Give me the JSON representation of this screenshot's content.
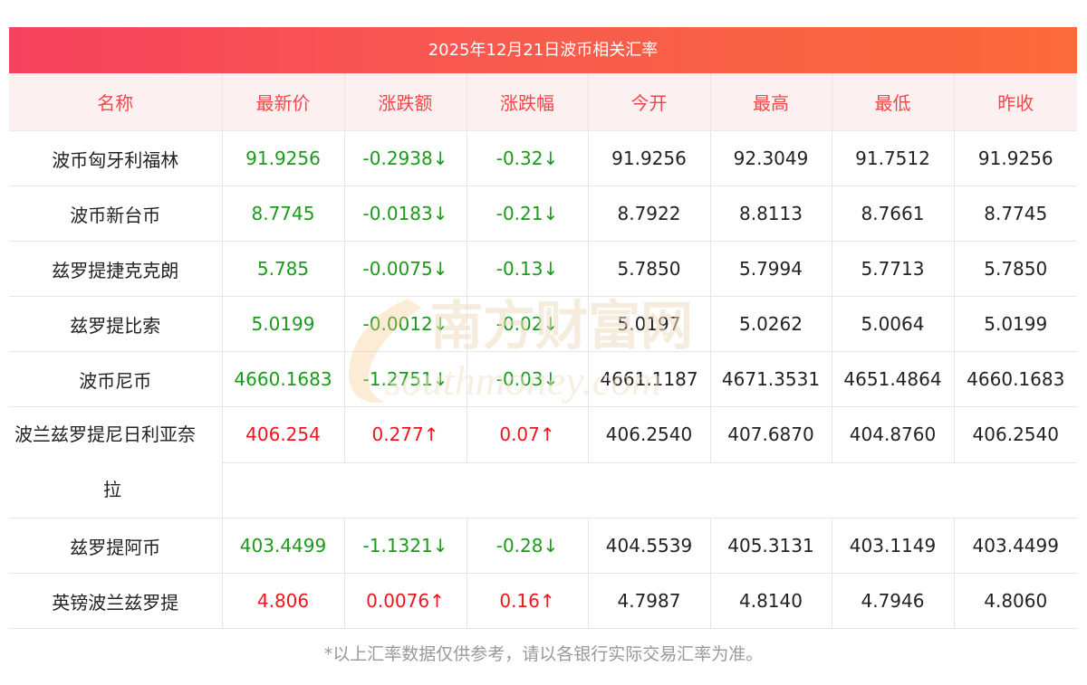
{
  "title": "2025年12月21日波币相关汇率",
  "headers": [
    "名称",
    "最新价",
    "涨跌额",
    "涨跌幅",
    "今开",
    "最高",
    "最低",
    "昨收"
  ],
  "rows": [
    {
      "name": "波币匈牙利福林",
      "latest": "91.9256",
      "change": "-0.2938↓",
      "pct": "-0.32↓",
      "open": "91.9256",
      "high": "92.3049",
      "low": "91.7512",
      "prev": "91.9256",
      "dir": "down"
    },
    {
      "name": "波币新台币",
      "latest": "8.7745",
      "change": "-0.0183↓",
      "pct": "-0.21↓",
      "open": "8.7922",
      "high": "8.8113",
      "low": "8.7661",
      "prev": "8.7745",
      "dir": "down"
    },
    {
      "name": "兹罗提捷克克朗",
      "latest": "5.785",
      "change": "-0.0075↓",
      "pct": "-0.13↓",
      "open": "5.7850",
      "high": "5.7994",
      "low": "5.7713",
      "prev": "5.7850",
      "dir": "down"
    },
    {
      "name": "兹罗提比索",
      "latest": "5.0199",
      "change": "-0.0012↓",
      "pct": "-0.02↓",
      "open": "5.0197",
      "high": "5.0262",
      "low": "5.0064",
      "prev": "5.0199",
      "dir": "down"
    },
    {
      "name": "波币尼币",
      "latest": "4660.1683",
      "change": "-1.2751↓",
      "pct": "-0.03↓",
      "open": "4661.1187",
      "high": "4671.3531",
      "low": "4651.4864",
      "prev": "4660.1683",
      "dir": "down"
    },
    {
      "name_line1": "波兰兹罗提尼日利亚奈",
      "name_line2": "拉",
      "latest": "406.254",
      "change": "0.277↑",
      "pct": "0.07↑",
      "open": "406.2540",
      "high": "407.6870",
      "low": "404.8760",
      "prev": "406.2540",
      "dir": "up"
    },
    {
      "name": "兹罗提阿币",
      "latest": "403.4499",
      "change": "-1.1321↓",
      "pct": "-0.28↓",
      "open": "404.5539",
      "high": "405.3131",
      "low": "403.1149",
      "prev": "403.4499",
      "dir": "down"
    },
    {
      "name": "英镑波兰兹罗提",
      "latest": "4.806",
      "change": "0.0076↑",
      "pct": "0.16↑",
      "open": "4.7987",
      "high": "4.8140",
      "low": "4.7946",
      "prev": "4.8060",
      "dir": "up"
    }
  ],
  "watermark": {
    "cn": "南方财富网",
    "en": "southmoney.com"
  },
  "footnote": "*以上汇率数据仅供参考，请以各银行实际交易汇率为准。",
  "colors": {
    "up": "#f0141e",
    "down": "#1a9b1a",
    "header_text": "#f0484a",
    "title_gradient_start": "#f6425e",
    "title_gradient_end": "#fb6a3a"
  }
}
